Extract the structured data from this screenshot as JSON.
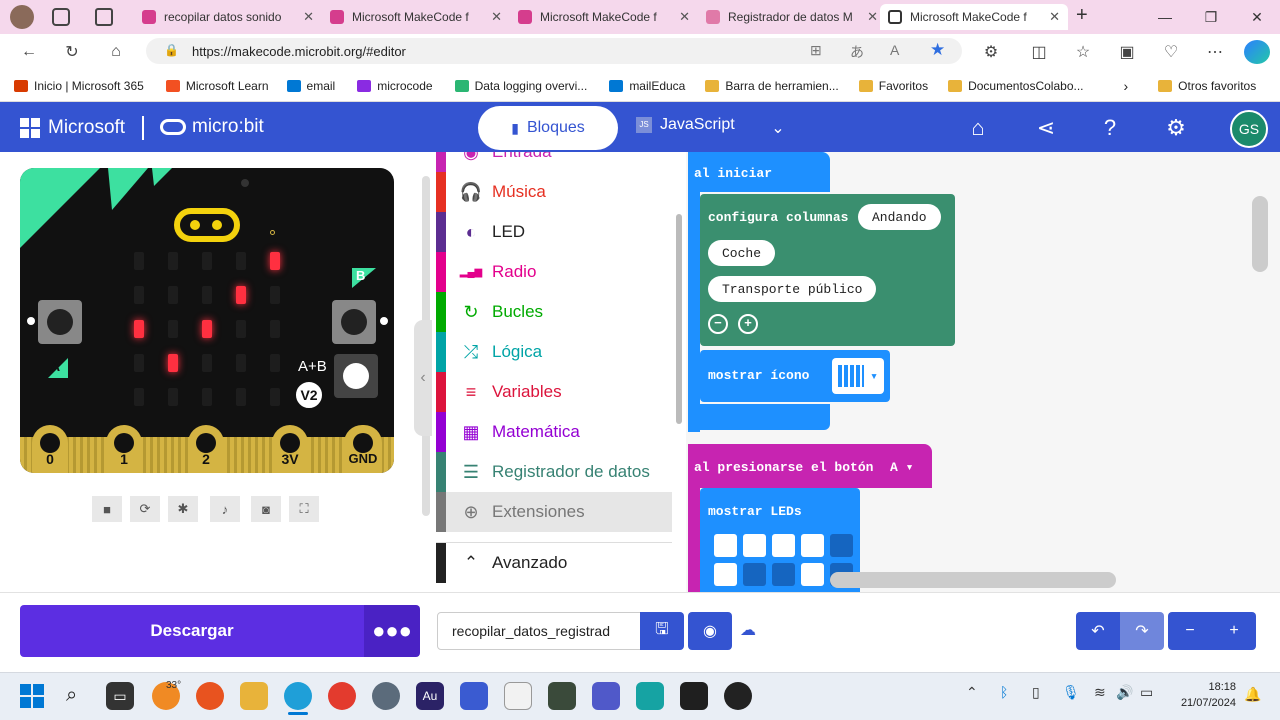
{
  "browser": {
    "tabs": [
      {
        "label": "recopilar datos sonido",
        "active": false
      },
      {
        "label": "Microsoft MakeCode f",
        "active": false
      },
      {
        "label": "Microsoft MakeCode f",
        "active": false
      },
      {
        "label": "Registrador de datos M",
        "active": false
      },
      {
        "label": "Microsoft MakeCode f",
        "active": true
      }
    ],
    "url": "https://makecode.microbit.org/#editor",
    "bookmarks": [
      {
        "label": "Inicio | Microsoft 365",
        "color": "#d83b01"
      },
      {
        "label": "Microsoft Learn",
        "color": "#f25022"
      },
      {
        "label": "email",
        "color": "#0078d4"
      },
      {
        "label": "microcode",
        "color": "#8a2be2"
      },
      {
        "label": "Data logging overvi...",
        "color": "#2bb673"
      },
      {
        "label": "mailEduca",
        "color": "#0078d4"
      },
      {
        "label": "Barra de herramien...",
        "color": "#e8b33a"
      },
      {
        "label": "Favoritos",
        "color": "#e8b33a"
      },
      {
        "label": "DocumentosColabo...",
        "color": "#e8b33a"
      }
    ],
    "other_favorites": "Otros favoritos"
  },
  "header": {
    "brand": "Microsoft",
    "product": "micro:bit",
    "mode_blocks": "Bloques",
    "mode_js": "JavaScript",
    "avatar": "GS"
  },
  "simulator": {
    "label_a": "A",
    "label_b": "B",
    "label_ab": "A+B",
    "version": "V2",
    "pins": [
      "0",
      "1",
      "2",
      "3V",
      "GND"
    ]
  },
  "toolbox": {
    "categories": [
      {
        "label": "Entrada",
        "color": "#c724b1",
        "icon": "circle-icon"
      },
      {
        "label": "Música",
        "color": "#e63022",
        "icon": "headphones-icon"
      },
      {
        "label": "LED",
        "color": "#5c2d91",
        "icon": "toggle-icon"
      },
      {
        "label": "Radio",
        "color": "#e3008c",
        "icon": "signal-icon"
      },
      {
        "label": "Bucles",
        "color": "#00aa00",
        "icon": "refresh-icon"
      },
      {
        "label": "Lógica",
        "color": "#00a4a6",
        "icon": "shuffle-icon"
      },
      {
        "label": "Variables",
        "color": "#dc143c",
        "icon": "list-icon"
      },
      {
        "label": "Matemática",
        "color": "#9400d3",
        "icon": "calculator-icon"
      },
      {
        "label": "Registrador de datos",
        "color": "#378273",
        "icon": "table-icon"
      },
      {
        "label": "Extensiones",
        "color": "#777777",
        "icon": "plus-circle-icon"
      }
    ],
    "advanced": "Avanzado"
  },
  "workspace": {
    "on_start": "al iniciar",
    "set_columns": "configura columnas",
    "columns": [
      "Andando",
      "Coche",
      "Transporte público"
    ],
    "show_icon": "mostrar ícono",
    "on_button": "al presionarse el botón",
    "button_value": "A",
    "show_leds": "mostrar LEDs"
  },
  "bottom": {
    "download": "Descargar",
    "project_name": "recopilar_datos_registrad"
  },
  "taskbar": {
    "temperature": "33°",
    "time": "18:18",
    "date": "21/07/2024"
  }
}
